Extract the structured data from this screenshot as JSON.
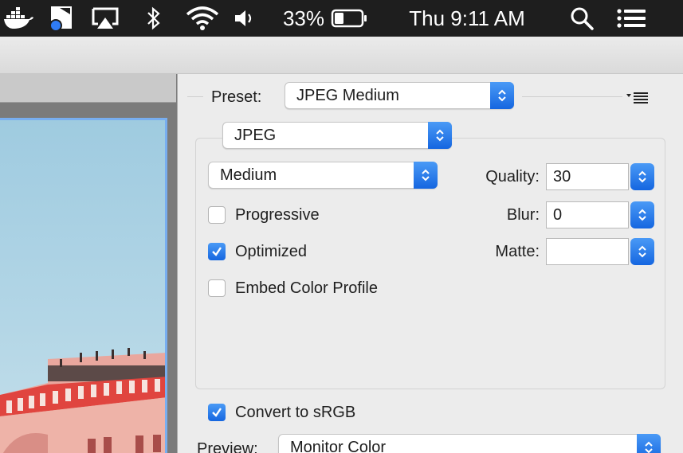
{
  "menubar": {
    "battery_percent": "33%",
    "battery_level": 0.33,
    "clock": "Thu 9:11 AM",
    "icons": [
      "docker-icon",
      "creative-cloud-icon",
      "airplay-icon",
      "bluetooth-icon",
      "wifi-icon",
      "volume-icon",
      "battery-icon",
      "spotlight-search-icon",
      "notification-center-icon"
    ]
  },
  "settings": {
    "preset_label": "Preset:",
    "preset_value": "JPEG Medium",
    "format_value": "JPEG",
    "quality_level_value": "Medium",
    "quality_label": "Quality:",
    "quality_value": "30",
    "blur_label": "Blur:",
    "blur_value": "0",
    "matte_label": "Matte:",
    "matte_value": "",
    "progressive_label": "Progressive",
    "progressive_checked": false,
    "optimized_label": "Optimized",
    "optimized_checked": true,
    "embed_profile_label": "Embed Color Profile",
    "embed_profile_checked": false,
    "convert_srgb_label": "Convert to sRGB",
    "convert_srgb_checked": true,
    "preview_label": "Preview:",
    "preview_value": "Monitor Color"
  },
  "colors": {
    "accent_blue": "#1566e0",
    "menubar_bg": "#1e1e1e",
    "window_bg": "#ececec"
  }
}
